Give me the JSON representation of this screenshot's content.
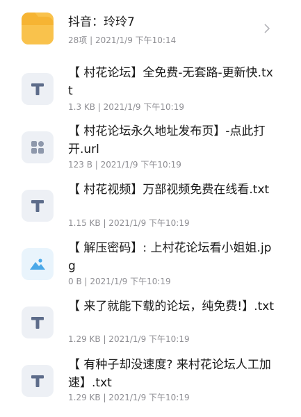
{
  "folder": {
    "title": "抖音：玲玲7",
    "meta": "28项  |  2021/1/9 下午10:14",
    "icon": "folder-icon"
  },
  "files": [
    {
      "title": "【 村花论坛】全免费-无套路-更新快.txt",
      "meta": "1.3 KB  |  2021/1/9 下午10:19",
      "icon": "text-file-icon"
    },
    {
      "title": "【 村花论坛永久地址发布页】-点此打开.url",
      "meta": "123 B  |  2021/1/9 下午10:19",
      "icon": "link-file-icon"
    },
    {
      "title": "【 村花视频】万部视频免费在线看.txt",
      "meta": "1.15 KB  |  2021/1/9 下午10:19",
      "icon": "text-file-icon"
    },
    {
      "title": "【 解压密码】: 上村花论坛看小姐姐.jpg",
      "meta": "0 B  |  2021/1/9 下午10:19",
      "icon": "image-file-icon"
    },
    {
      "title": "【 来了就能下载的论坛，纯免费!】.txt",
      "meta": "1.29 KB  |  2021/1/9 下午10:19",
      "icon": "text-file-icon"
    },
    {
      "title": "【 有种子却没速度? 来村花论坛人工加速】.txt",
      "meta": "1.29 KB  |  2021/1/9 下午10:19",
      "icon": "text-file-icon"
    }
  ]
}
